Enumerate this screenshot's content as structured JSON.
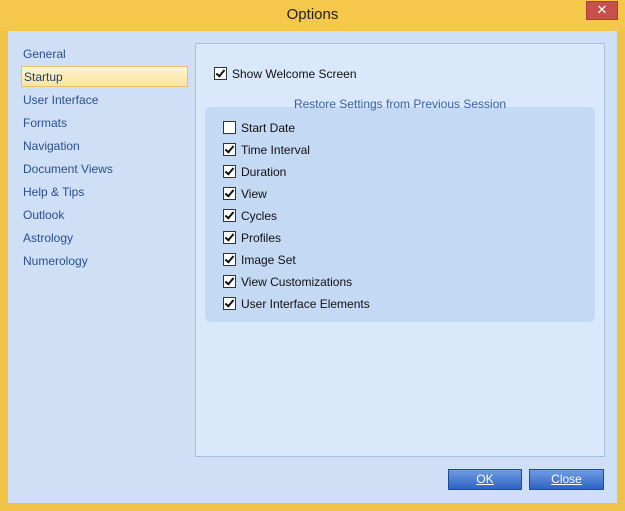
{
  "window": {
    "title": "Options",
    "close_glyph": "✕"
  },
  "sidebar": {
    "items": [
      {
        "label": "General",
        "selected": false
      },
      {
        "label": "Startup",
        "selected": true
      },
      {
        "label": "User Interface",
        "selected": false
      },
      {
        "label": "Formats",
        "selected": false
      },
      {
        "label": "Navigation",
        "selected": false
      },
      {
        "label": "Document Views",
        "selected": false
      },
      {
        "label": "Help & Tips",
        "selected": false
      },
      {
        "label": "Outlook",
        "selected": false
      },
      {
        "label": "Astrology",
        "selected": false
      },
      {
        "label": "Numerology",
        "selected": false
      }
    ]
  },
  "startup": {
    "show_welcome": {
      "label": "Show Welcome Screen",
      "checked": true
    },
    "restore_group": {
      "title": "Restore Settings from Previous Session",
      "items": [
        {
          "label": "Start Date",
          "checked": false
        },
        {
          "label": "Time Interval",
          "checked": true
        },
        {
          "label": "Duration",
          "checked": true
        },
        {
          "label": "View",
          "checked": true
        },
        {
          "label": "Cycles",
          "checked": true
        },
        {
          "label": "Profiles",
          "checked": true
        },
        {
          "label": "Image Set",
          "checked": true
        },
        {
          "label": "View Customizations",
          "checked": true
        },
        {
          "label": "User Interface Elements",
          "checked": true
        }
      ]
    }
  },
  "buttons": {
    "ok": "OK",
    "close": "Close"
  },
  "colors": {
    "title_bar": "#f5c84c",
    "client_bg": "#cfe0f6",
    "nav_text": "#2a4f8c",
    "button_blue": "#2f63c4"
  }
}
